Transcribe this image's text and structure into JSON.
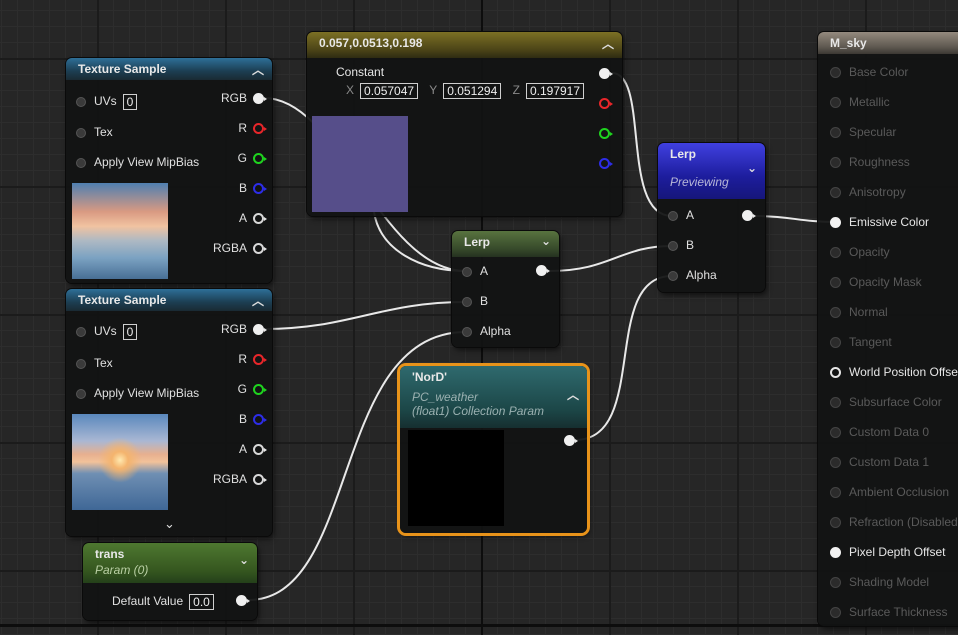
{
  "texture1": {
    "title": "Texture Sample",
    "uvs_label": "UVs",
    "uvs_value": "0",
    "tex_label": "Tex",
    "mipbias_label": "Apply View MipBias",
    "outputs": [
      "RGB",
      "R",
      "G",
      "B",
      "A",
      "RGBA"
    ]
  },
  "texture2": {
    "title": "Texture Sample",
    "uvs_label": "UVs",
    "uvs_value": "0",
    "tex_label": "Tex",
    "mipbias_label": "Apply View MipBias",
    "outputs": [
      "RGB",
      "R",
      "G",
      "B",
      "A",
      "RGBA"
    ]
  },
  "constant": {
    "title": "0.057,0.0513,0.198",
    "label": "Constant",
    "x_label": "X",
    "x_value": "0.057047",
    "y_label": "Y",
    "y_value": "0.051294",
    "z_label": "Z",
    "z_value": "0.197917",
    "swatch_color": "#564e8a"
  },
  "lerp_mid": {
    "title": "Lerp",
    "inputs": [
      "A",
      "B",
      "Alpha"
    ]
  },
  "lerp_main": {
    "title": "Lerp",
    "status": "Previewing",
    "inputs": [
      "A",
      "B",
      "Alpha"
    ]
  },
  "nord": {
    "title": "'NorD'",
    "subtitle1": "PC_weather",
    "subtitle2": "(float1) Collection Param"
  },
  "trans": {
    "title": "trans",
    "subtitle": "Param (0)",
    "default_label": "Default Value",
    "default_value": "0.0"
  },
  "material": {
    "title": "M_sky",
    "pins": [
      {
        "label": "Base Color",
        "active": false
      },
      {
        "label": "Metallic",
        "active": false
      },
      {
        "label": "Specular",
        "active": false
      },
      {
        "label": "Roughness",
        "active": false
      },
      {
        "label": "Anisotropy",
        "active": false
      },
      {
        "label": "Emissive Color",
        "active": true
      },
      {
        "label": "Opacity",
        "active": false
      },
      {
        "label": "Opacity Mask",
        "active": false
      },
      {
        "label": "Normal",
        "active": false
      },
      {
        "label": "Tangent",
        "active": false
      },
      {
        "label": "World Position Offset",
        "active": true
      },
      {
        "label": "Subsurface Color",
        "active": false
      },
      {
        "label": "Custom Data 0",
        "active": false
      },
      {
        "label": "Custom Data 1",
        "active": false
      },
      {
        "label": "Ambient Occlusion",
        "active": false
      },
      {
        "label": "Refraction (Disabled)",
        "active": false
      },
      {
        "label": "Pixel Depth Offset",
        "active": true
      },
      {
        "label": "Shading Model",
        "active": false
      },
      {
        "label": "Surface Thickness",
        "active": false
      }
    ]
  }
}
